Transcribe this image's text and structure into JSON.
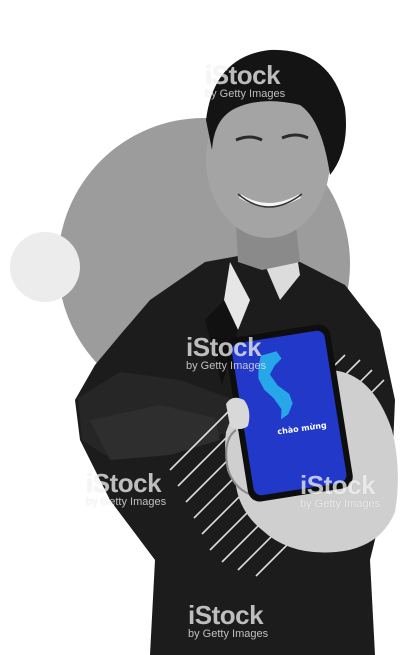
{
  "phone": {
    "greeting": "chào mừng"
  },
  "watermark": {
    "brand": "iStock",
    "credit": "by Getty Images"
  },
  "colors": {
    "phone_screen": "#2238c8",
    "map_shape": "#27a6e8",
    "background": "#ffffff",
    "circle": "#9c9c9c"
  }
}
